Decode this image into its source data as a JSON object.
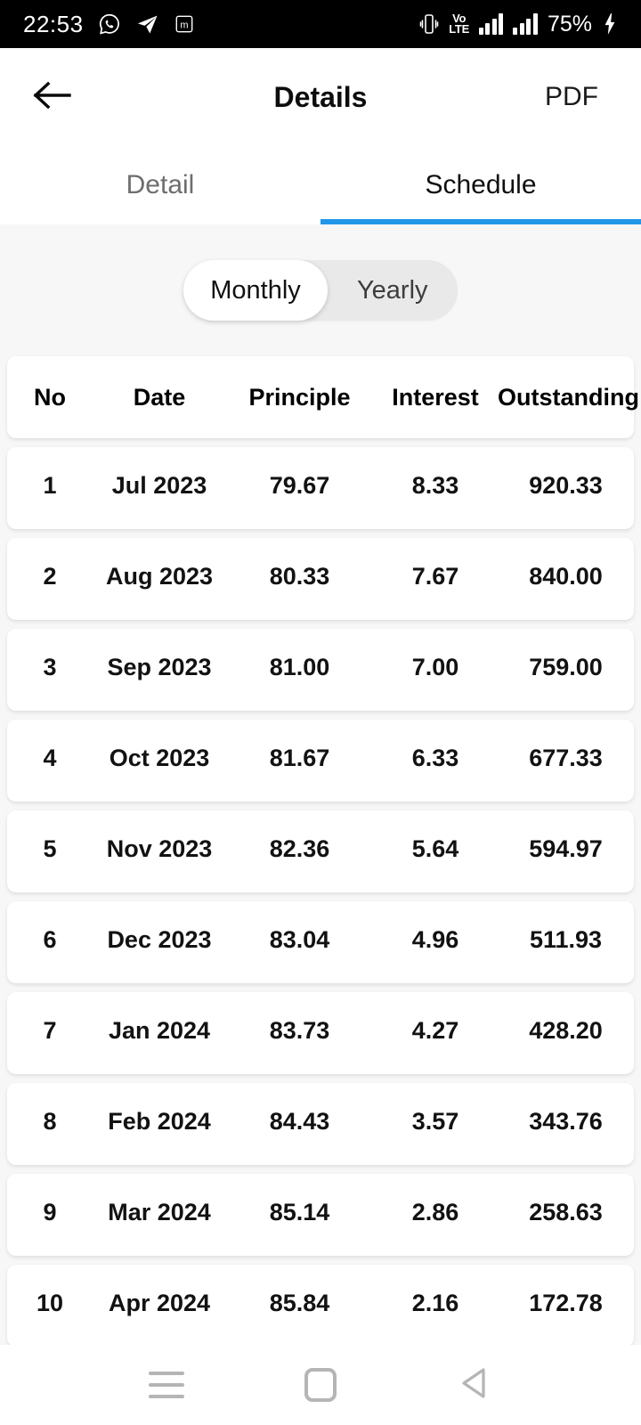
{
  "status_bar": {
    "time": "22:53",
    "battery": "75%",
    "icons": [
      "whatsapp-icon",
      "telegram-icon",
      "m-app-icon",
      "vibrate-icon",
      "volte-icon",
      "signal-bars-1",
      "signal-bars-2",
      "charging-bolt-icon"
    ],
    "volte_top": "Vo",
    "volte_bottom": "LTE"
  },
  "appbar": {
    "back_label": "",
    "title": "Details",
    "action_label": "PDF"
  },
  "tabs": {
    "items": [
      {
        "label": "Detail",
        "active": false
      },
      {
        "label": "Schedule",
        "active": true
      }
    ],
    "indicator_color": "#2196e8"
  },
  "segment": {
    "options": [
      {
        "label": "Monthly",
        "selected": true
      },
      {
        "label": "Yearly",
        "selected": false
      }
    ]
  },
  "table": {
    "headers": [
      "No",
      "Date",
      "Principle",
      "Interest",
      "Outstanding"
    ],
    "rows": [
      {
        "no": "1",
        "date": "Jul 2023",
        "principle": "79.67",
        "interest": "8.33",
        "outstanding": "920.33"
      },
      {
        "no": "2",
        "date": "Aug 2023",
        "principle": "80.33",
        "interest": "7.67",
        "outstanding": "840.00"
      },
      {
        "no": "3",
        "date": "Sep 2023",
        "principle": "81.00",
        "interest": "7.00",
        "outstanding": "759.00"
      },
      {
        "no": "4",
        "date": "Oct 2023",
        "principle": "81.67",
        "interest": "6.33",
        "outstanding": "677.33"
      },
      {
        "no": "5",
        "date": "Nov 2023",
        "principle": "82.36",
        "interest": "5.64",
        "outstanding": "594.97"
      },
      {
        "no": "6",
        "date": "Dec 2023",
        "principle": "83.04",
        "interest": "4.96",
        "outstanding": "511.93"
      },
      {
        "no": "7",
        "date": "Jan 2024",
        "principle": "83.73",
        "interest": "4.27",
        "outstanding": "428.20"
      },
      {
        "no": "8",
        "date": "Feb 2024",
        "principle": "84.43",
        "interest": "3.57",
        "outstanding": "343.76"
      },
      {
        "no": "9",
        "date": "Mar 2024",
        "principle": "85.14",
        "interest": "2.86",
        "outstanding": "258.63"
      },
      {
        "no": "10",
        "date": "Apr 2024",
        "principle": "85.84",
        "interest": "2.16",
        "outstanding": "172.78"
      }
    ]
  },
  "navbar": {
    "buttons": [
      "recents-icon",
      "home-icon",
      "back-triangle-icon"
    ]
  }
}
